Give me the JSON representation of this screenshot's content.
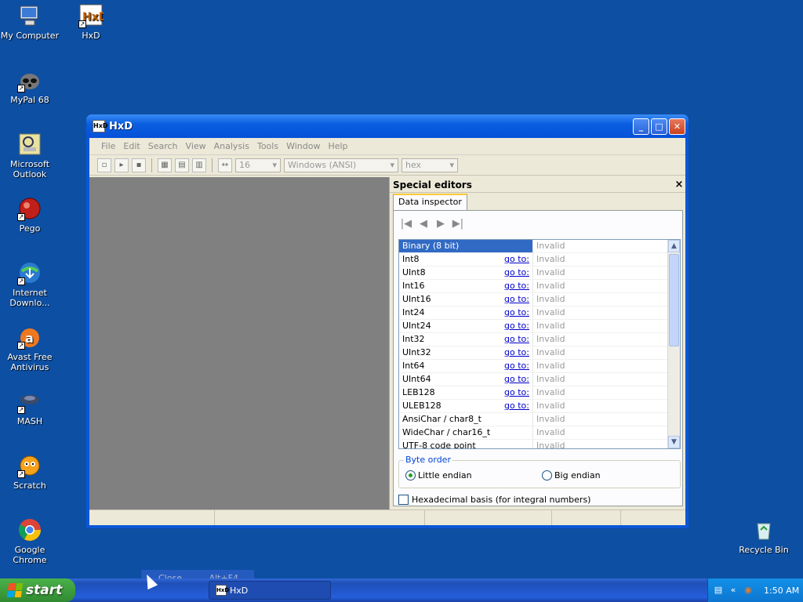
{
  "desktop": {
    "icons": [
      {
        "label": "My Computer"
      },
      {
        "label": "HxD"
      },
      {
        "label": "MyPal 68"
      },
      {
        "label": "Microsoft Outlook"
      },
      {
        "label": "Pego"
      },
      {
        "label": "Internet Downlo..."
      },
      {
        "label": "Avast Free Antivirus"
      },
      {
        "label": "MASH"
      },
      {
        "label": "Scratch"
      },
      {
        "label": "Google Chrome"
      },
      {
        "label": "Recycle Bin"
      }
    ]
  },
  "window": {
    "title": "HxD",
    "menu": [
      "File",
      "Edit",
      "Search",
      "View",
      "Analysis",
      "Tools",
      "Window",
      "Help"
    ],
    "toolbar": {
      "bytes_per_row": "16",
      "charset": "Windows (ANSI)",
      "offset_base": "hex"
    },
    "panel": {
      "title": "Special editors",
      "close_glyph": "×",
      "tab": "Data inspector",
      "rows": [
        {
          "name": "Binary (8 bit)",
          "goto": "",
          "value": "Invalid"
        },
        {
          "name": "Int8",
          "goto": "go to:",
          "value": "Invalid"
        },
        {
          "name": "UInt8",
          "goto": "go to:",
          "value": "Invalid"
        },
        {
          "name": "Int16",
          "goto": "go to:",
          "value": "Invalid"
        },
        {
          "name": "UInt16",
          "goto": "go to:",
          "value": "Invalid"
        },
        {
          "name": "Int24",
          "goto": "go to:",
          "value": "Invalid"
        },
        {
          "name": "UInt24",
          "goto": "go to:",
          "value": "Invalid"
        },
        {
          "name": "Int32",
          "goto": "go to:",
          "value": "Invalid"
        },
        {
          "name": "UInt32",
          "goto": "go to:",
          "value": "Invalid"
        },
        {
          "name": "Int64",
          "goto": "go to:",
          "value": "Invalid"
        },
        {
          "name": "UInt64",
          "goto": "go to:",
          "value": "Invalid"
        },
        {
          "name": "LEB128",
          "goto": "go to:",
          "value": "Invalid"
        },
        {
          "name": "ULEB128",
          "goto": "go to:",
          "value": "Invalid"
        },
        {
          "name": "AnsiChar / char8_t",
          "goto": "",
          "value": "Invalid"
        },
        {
          "name": "WideChar / char16_t",
          "goto": "",
          "value": "Invalid"
        },
        {
          "name": "UTF-8 code point",
          "goto": "",
          "value": "Invalid"
        }
      ],
      "byte_order": {
        "title": "Byte order",
        "little": "Little endian",
        "big": "Big endian",
        "selected": "little"
      },
      "hex_basis": "Hexadecimal basis (for integral numbers)"
    }
  },
  "context_menu": {
    "label": "Close",
    "shortcut": "Alt+F4"
  },
  "taskbar": {
    "start": "start",
    "task": "HxD",
    "clock": "1:50 AM"
  },
  "colors": {
    "desktop": "#0d4fa3",
    "selection": "#316ac5",
    "link": "#0000cc"
  }
}
